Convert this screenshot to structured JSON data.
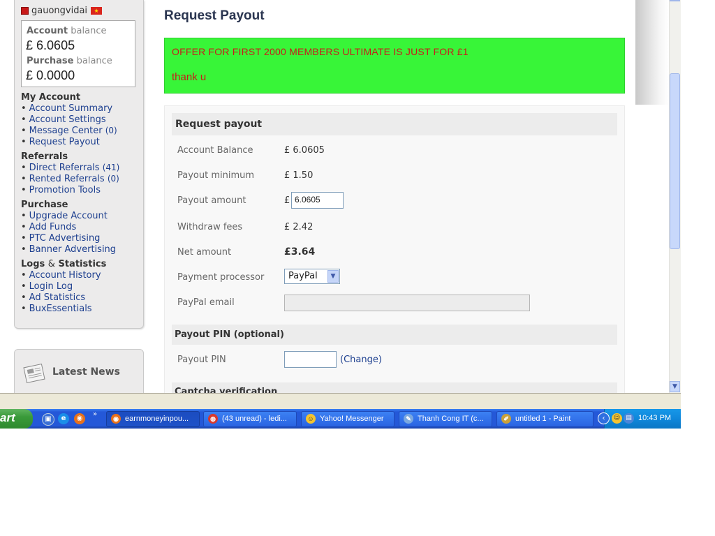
{
  "sidebar": {
    "username": "gauongvidai",
    "account_balance_label_bold": "Account",
    "account_balance_label_rest": "balance",
    "account_balance_currency": "£",
    "account_balance_value": "6.0605",
    "purchase_balance_label_bold": "Purchase",
    "purchase_balance_label_rest": "balance",
    "purchase_balance_currency": "£",
    "purchase_balance_value": "0.0000",
    "sections": [
      {
        "heading": "My Account",
        "items": [
          {
            "label": "Account Summary"
          },
          {
            "label": "Account Settings"
          },
          {
            "label": "Message Center",
            "count": "(0)"
          },
          {
            "label": "Request Payout"
          }
        ]
      },
      {
        "heading": "Referrals",
        "items": [
          {
            "label": "Direct Referrals",
            "count": "(41)"
          },
          {
            "label": "Rented Referrals",
            "count": "(0)"
          },
          {
            "label": "Promotion Tools"
          }
        ]
      },
      {
        "heading": "Purchase",
        "items": [
          {
            "label": "Upgrade Account"
          },
          {
            "label": "Add Funds"
          },
          {
            "label": "PTC Advertising"
          },
          {
            "label": "Banner Advertising"
          }
        ]
      },
      {
        "heading_part1": "Logs",
        "heading_amp": "&",
        "heading_part2": "Statistics",
        "items": [
          {
            "label": "Account History"
          },
          {
            "label": "Login Log"
          },
          {
            "label": "Ad Statistics"
          },
          {
            "label": "BuxEssentials"
          }
        ]
      }
    ],
    "news_title": "Latest News"
  },
  "main": {
    "title": "Request Payout",
    "offer_line1": "OFFER FOR FIRST 2000 MEMBERS ULTIMATE IS JUST FOR £1",
    "offer_line2": "thank u",
    "section_payout": "Request payout",
    "fields": {
      "account_balance_label": "Account Balance",
      "account_balance_value": "£ 6.0605",
      "payout_minimum_label": "Payout minimum",
      "payout_minimum_value": "£ 1.50",
      "payout_amount_label": "Payout amount",
      "payout_amount_currency": "£",
      "payout_amount_value": "6.0605",
      "withdraw_fees_label": "Withdraw fees",
      "withdraw_fees_value": "£ 2.42",
      "net_amount_label": "Net amount",
      "net_amount_value": "£3.64",
      "processor_label": "Payment processor",
      "processor_value": "PayPal",
      "email_label": "PayPal email",
      "email_value": ""
    },
    "section_pin": "Payout PIN (optional)",
    "pin_label": "Payout PIN",
    "pin_value": "",
    "pin_change_open": "(",
    "pin_change_link": "Change",
    "pin_change_close": ")",
    "section_captcha": "Captcha verification"
  },
  "taskbar": {
    "start_label": "art",
    "quicklaunch_more": "»",
    "buttons": [
      {
        "label": "earnmoneyinpou...",
        "icon": "firefox-icon",
        "active": true
      },
      {
        "label": "(43 unread) - ledi...",
        "icon": "chrome-icon",
        "active": false
      },
      {
        "label": "Yahoo! Messenger",
        "icon": "yahoo-messenger-icon",
        "active": false
      },
      {
        "label": "Thanh Cong IT (c...",
        "icon": "chat-icon",
        "active": false
      },
      {
        "label": "untitled 1 - Paint",
        "icon": "paint-icon",
        "active": false
      }
    ],
    "clock": "10:43 PM"
  },
  "colors": {
    "offer_background": "#38f538",
    "offer_text": "#c81b1b",
    "link": "#1d3f8f",
    "taskbar": "#2458d8",
    "start_button": "#3a9a3a",
    "tray": "#0f87db"
  }
}
